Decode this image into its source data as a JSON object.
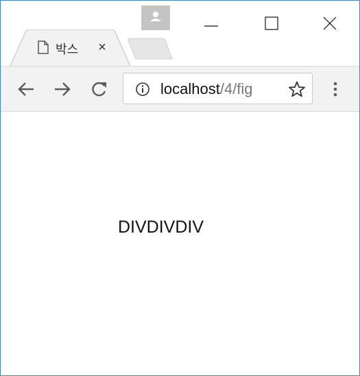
{
  "tab": {
    "title": "박스",
    "close_glyph": "×",
    "page_icon": "document-icon"
  },
  "window_controls": {
    "profile_icon": "person-icon",
    "minimize_icon": "minimize-icon",
    "maximize_icon": "maximize-icon",
    "close_icon": "close-icon"
  },
  "toolbar": {
    "back_icon": "arrow-left-icon",
    "forward_icon": "arrow-right-icon",
    "reload_icon": "reload-icon",
    "menu_icon": "kebab-menu-icon"
  },
  "address_bar": {
    "host": "localhost",
    "path": "/4/fig",
    "info_icon": "info-icon",
    "bookmark_icon": "star-icon"
  },
  "page": {
    "text": "DIVDIVDIV"
  },
  "colors": {
    "window_border": "#4a7fc1",
    "toolbar_bg": "#f2f2f2",
    "profile_bg": "#c4c4c4",
    "url_path": "#777777"
  }
}
